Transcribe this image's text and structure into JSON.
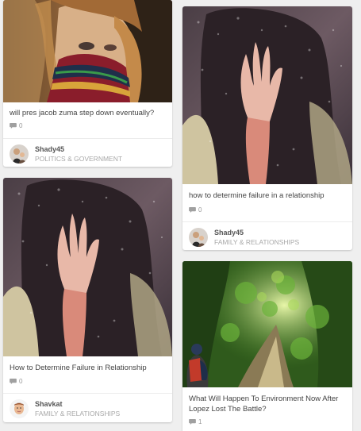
{
  "feed": {
    "cards": [
      {
        "title": "will pres jacob zuma step down eventually?",
        "comments": "0",
        "author": "Shady45",
        "category": "POLITICS & GOVERNMENT",
        "image_icon": "woman-scarf-photo",
        "avatar_icon": "man-with-child-avatar"
      },
      {
        "title": "how to determine failure in a relationship",
        "comments": "0",
        "author": "Shady45",
        "category": "FAMILY & RELATIONSHIPS",
        "image_icon": "hand-on-rainy-window-photo",
        "avatar_icon": "man-with-child-avatar"
      },
      {
        "title": "How to Determine Failure in Relationship",
        "comments": "0",
        "author": "Shavkat",
        "category": "FAMILY & RELATIONSHIPS",
        "image_icon": "hand-on-rainy-window-photo",
        "avatar_icon": "man-face-avatar"
      },
      {
        "title": "What Will Happen To Environment Now After Lopez Lost The Battle?",
        "comments": "1",
        "image_icon": "forest-hiker-photo"
      }
    ]
  },
  "colors": {
    "background": "#efefef",
    "card": "#ffffff",
    "title_text": "#444444",
    "category_text": "#a8a8a8"
  }
}
